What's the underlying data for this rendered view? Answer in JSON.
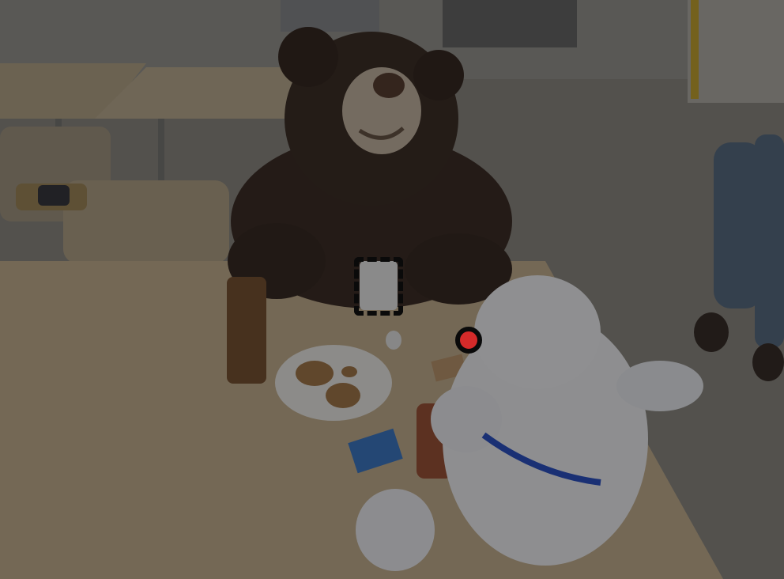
{
  "scene": {
    "overlay_color": "#000000",
    "dim_opacity": 0.42
  },
  "annotations": {
    "box_marker_color": "#0a0a0a",
    "point_marker_color": "#d42a2a"
  }
}
